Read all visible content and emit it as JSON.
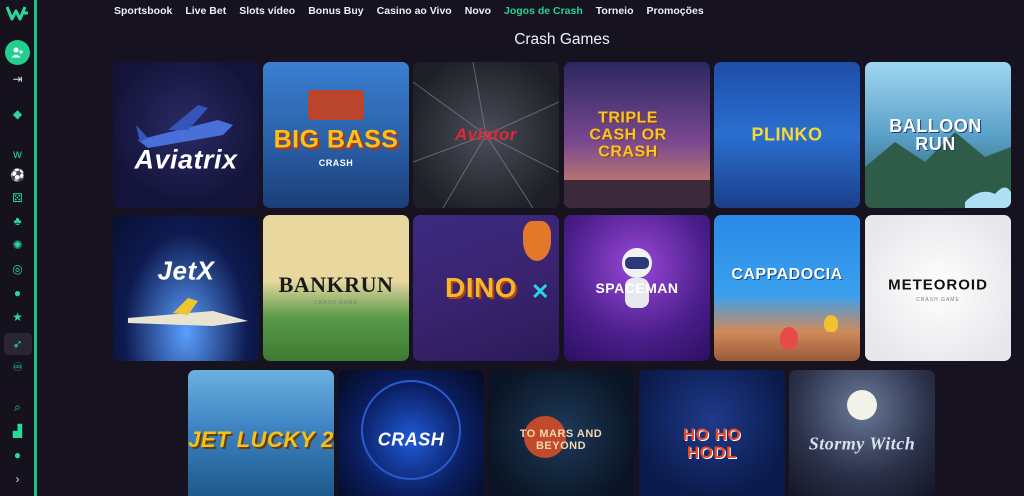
{
  "nav": {
    "items": [
      "Sportsbook",
      "Live Bet",
      "Slots vídeo",
      "Bonus Buy",
      "Casino ao Vivo",
      "Novo",
      "Jogos de Crash",
      "Torneio",
      "Promoções"
    ],
    "active_index": 6
  },
  "section_title": "Crash Games",
  "games": [
    {
      "title": "Aviatrix",
      "subtitle": ""
    },
    {
      "title": "BIG BASS",
      "subtitle": "CRASH"
    },
    {
      "title": "Aviator",
      "subtitle": ""
    },
    {
      "title": "TRIPLE CASH OR CRASH",
      "subtitle": ""
    },
    {
      "title": "PLINKO",
      "subtitle": ""
    },
    {
      "title": "BALLOON RUN",
      "subtitle": ""
    },
    {
      "title": "JetX",
      "subtitle": ""
    },
    {
      "title": "BANKRUN",
      "subtitle": "CRASH GAME"
    },
    {
      "title": "DINO",
      "subtitle": ""
    },
    {
      "title": "SPACEMAN",
      "subtitle": ""
    },
    {
      "title": "CAPPADOCIA",
      "subtitle": ""
    },
    {
      "title": "METEOROID",
      "subtitle": "CRASH GAME"
    },
    {
      "title": "JET LUCKY 2",
      "subtitle": ""
    },
    {
      "title": "CRASH",
      "subtitle": ""
    },
    {
      "title": "TO MARS AND BEYOND",
      "subtitle": ""
    },
    {
      "title": "HO HO HODL",
      "subtitle": ""
    },
    {
      "title": "Stormy Witch",
      "subtitle": ""
    }
  ],
  "sidebar_icons": [
    "user-add-icon",
    "logout-icon",
    "diamond-icon",
    "logo-icon",
    "soccer-icon",
    "dice-icon",
    "cherries-icon",
    "roulette-icon",
    "casino-chip-icon",
    "live-icon",
    "star-icon",
    "rocket-icon",
    "handshake-icon",
    "search-icon",
    "stats-icon",
    "chat-icon",
    "expand-icon"
  ],
  "colors": {
    "accent": "#1fd494",
    "background": "#16121f"
  }
}
